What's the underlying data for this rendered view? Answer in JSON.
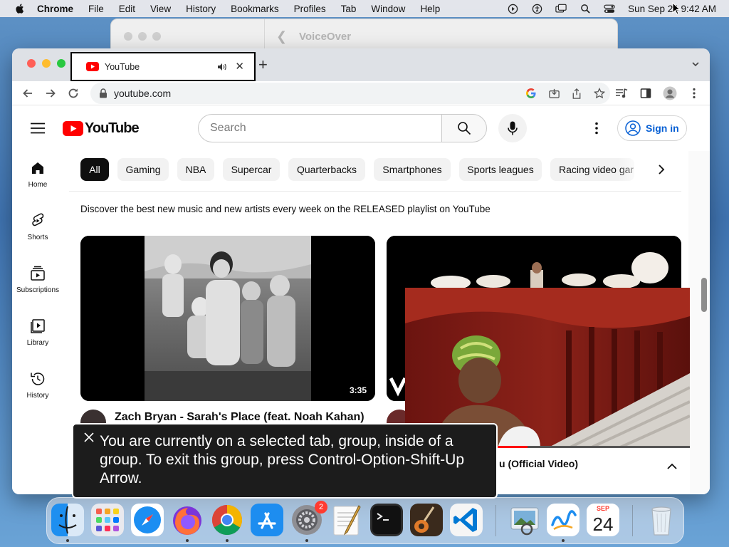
{
  "menubar": {
    "app_name": "Chrome",
    "items": [
      "File",
      "Edit",
      "View",
      "History",
      "Bookmarks",
      "Profiles",
      "Tab",
      "Window",
      "Help"
    ],
    "clock": "Sun Sep 24  9:42 AM",
    "status_icons": [
      "play-circle-icon",
      "accessibility-icon",
      "screen-mirror-icon",
      "spotlight-search-icon",
      "control-center-icon"
    ]
  },
  "voiceover_window": {
    "title": "VoiceOver"
  },
  "browser": {
    "tab": {
      "title": "YouTube"
    },
    "address": "youtube.com"
  },
  "youtube": {
    "logo_text": "YouTube",
    "search_placeholder": "Search",
    "sign_in": "Sign in",
    "sidebar": [
      {
        "label": "Home",
        "icon": "home-icon"
      },
      {
        "label": "Shorts",
        "icon": "shorts-icon"
      },
      {
        "label": "Subscriptions",
        "icon": "subscriptions-icon"
      },
      {
        "label": "Library",
        "icon": "library-icon"
      },
      {
        "label": "History",
        "icon": "history-icon"
      }
    ],
    "chips": [
      "All",
      "Gaming",
      "NBA",
      "Supercar",
      "Quarterbacks",
      "Smartphones",
      "Sports leagues",
      "Racing video gar"
    ],
    "promo_text": "Discover the best new music and new artists every week on the RELEASED playlist on YouTube",
    "videos": [
      {
        "title": "Zach Bryan - Sarah's Place (feat. Noah Kahan)",
        "duration": "3:35"
      }
    ],
    "pip": {
      "caption": "u (Official Video)",
      "progress": 0.43
    }
  },
  "voiceover_caption": "You are currently on a selected tab, group, inside of a group.  To exit this group, press Control-Option-Shift-Up Arrow.",
  "dock": {
    "apps": [
      "finder",
      "launchpad",
      "safari",
      "firefox",
      "chrome",
      "app-store",
      "system-settings",
      "textedit",
      "terminal",
      "garageband",
      "vscode",
      "preview",
      "freeform",
      "calendar",
      "trash"
    ],
    "system_settings_badge": "2",
    "calendar": {
      "month": "SEP",
      "day": "24"
    }
  },
  "colors": {
    "youtube_red": "#ff0000",
    "link_blue": "#065fd4",
    "chip_active": "#0f0f0f"
  }
}
